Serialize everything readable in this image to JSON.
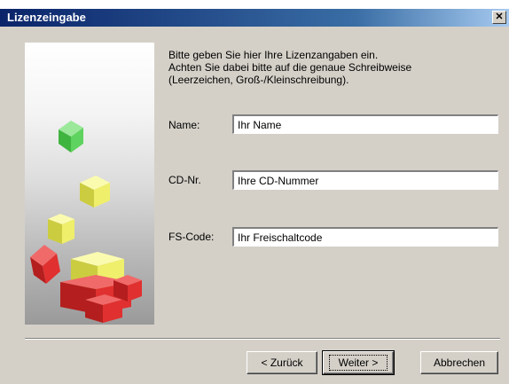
{
  "window": {
    "title": "Lizenzeingabe",
    "close_glyph": "✕"
  },
  "intro": {
    "line1": "Bitte geben Sie hier Ihre Lizenzangaben ein.",
    "line2": "Achten Sie dabei bitte auf die genaue Schreibweise",
    "line3": "(Leerzeichen, Groß-/Kleinschreibung)."
  },
  "form": {
    "name_label": "Name:",
    "name_value": "Ihr Name",
    "cd_label": "CD-Nr.",
    "cd_value": "Ihre CD-Nummer",
    "fs_label": "FS-Code:",
    "fs_value": "Ihr Freischaltcode"
  },
  "buttons": {
    "back_label": "< Zurück",
    "next_label": "Weiter >",
    "cancel_label": "Abbrechen"
  },
  "colors": {
    "titlebar_start": "#0a246a",
    "titlebar_end": "#a6caf0",
    "dialog_bg": "#d4d0c8",
    "cube_green": "#5fd35f",
    "cube_yellow": "#f2f26b",
    "cube_red": "#e03030"
  },
  "icons": {
    "close": "close-icon",
    "illustration": "falling-cubes-illustration"
  }
}
